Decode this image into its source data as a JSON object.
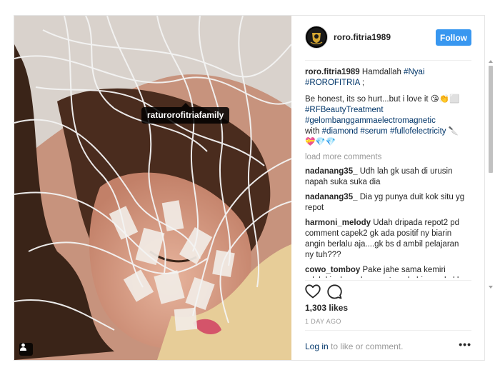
{
  "photo": {
    "tag_label": "raturorofitriafamily"
  },
  "header": {
    "username": "roro.fitria1989",
    "follow_label": "Follow"
  },
  "caption": {
    "username": "roro.fitria1989",
    "line1_text": "Hamdallah",
    "line1_tag1": "#Nyai",
    "line1_tag2": "#ROROFITRIA",
    "line1_end": ";",
    "line2_text": "Be honest, its so hurt...but i love it",
    "line2_emoji": "😘👏⬜",
    "tag_rf": "#RFBeautyTreatment",
    "tag_gelombang": "#gelombanggammaelectromagnetic",
    "with_text": "with",
    "tag_diamond": "#diamond",
    "tag_serum": "#serum",
    "tag_full": "#fullofelectricity",
    "end_emoji": "🔪 💝💎💎"
  },
  "load_more": "load more comments",
  "comments": [
    {
      "user": "nadanang35_",
      "text": "Udh lah gk usah di urusin napah suka suka dia"
    },
    {
      "user": "nadanang35_",
      "text": "Dia yg punya duit kok situ yg repot"
    },
    {
      "user": "harmoni_melody",
      "text": "Udah dripada repot2 pd comment capek2 gk ada positif ny biarin angin berlalu aja....gk bs d ambil pelajaran ny tuh???"
    },
    {
      "user": "cowo_tomboy",
      "text": "Pake jahe sama kemiri udah kinclong dan awet muda hiro perlu klo"
    }
  ],
  "actions": {
    "like_icon": "heart-icon",
    "comment_icon": "comment-bubble-icon"
  },
  "likes": "1,303 likes",
  "time_ago": "1 DAY AGO",
  "comment_box": {
    "login_label": "Log in",
    "rest_label": "to like or comment."
  },
  "more_icon": "•••",
  "colors": {
    "follow_button": "#3897f0",
    "hashtag": "#003569",
    "muted": "#999999"
  }
}
